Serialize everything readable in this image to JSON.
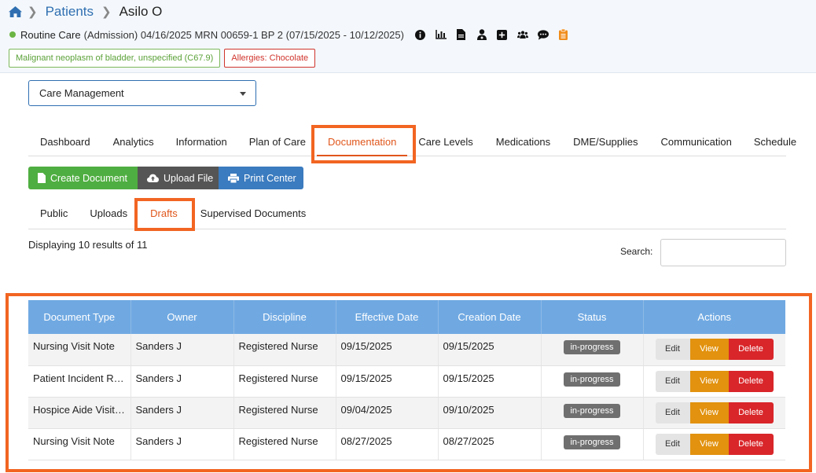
{
  "breadcrumb": {
    "home_icon": "home-icon",
    "patients": "Patients",
    "patient": "Asilo O"
  },
  "visit": {
    "status_color": "#6bb544",
    "type": "Routine Care",
    "details": "(Admission) 04/16/2025 MRN 00659-1 BP 2 (07/15/2025 - 10/12/2025)",
    "icons": [
      "info-icon",
      "bar-chart-icon",
      "document-icon",
      "user-doctor-icon",
      "plus-square-icon",
      "users-icon",
      "chat-icon",
      "clipboard-icon"
    ]
  },
  "tags": {
    "diagnosis": "Malignant neoplasm of bladder, unspecified (C67.9)",
    "allergies": "Allergies: Chocolate"
  },
  "care_select": {
    "value": "Care Management"
  },
  "tabs": [
    "Dashboard",
    "Analytics",
    "Information",
    "Plan of Care",
    "Documentation",
    "Care Levels",
    "Medications",
    "DME/Supplies",
    "Communication",
    "Schedule"
  ],
  "active_tab": "Documentation",
  "actions": {
    "create": "Create Document",
    "upload": "Upload File",
    "print": "Print Center"
  },
  "subtabs": [
    "Public",
    "Uploads",
    "Drafts",
    "Supervised Documents"
  ],
  "active_subtab": "Drafts",
  "results": "Displaying 10 results of 11",
  "search": {
    "label": "Search:",
    "value": ""
  },
  "table": {
    "columns": [
      "Document Type",
      "Owner",
      "Discipline",
      "Effective Date",
      "Creation Date",
      "Status",
      "Actions"
    ],
    "rows": [
      {
        "doc_type": "Nursing Visit Note",
        "owner": "Sanders J",
        "discipline": "Registered Nurse",
        "effective": "09/15/2025",
        "created": "09/15/2025",
        "status": "in-progress"
      },
      {
        "doc_type": "Patient Incident Report",
        "owner": "Sanders J",
        "discipline": "Registered Nurse",
        "effective": "09/15/2025",
        "created": "09/15/2025",
        "status": "in-progress"
      },
      {
        "doc_type": "Hospice Aide Visit Note",
        "owner": "Sanders J",
        "discipline": "Registered Nurse",
        "effective": "09/04/2025",
        "created": "09/10/2025",
        "status": "in-progress"
      },
      {
        "doc_type": "Nursing Visit Note",
        "owner": "Sanders J",
        "discipline": "Registered Nurse",
        "effective": "08/27/2025",
        "created": "08/27/2025",
        "status": "in-progress"
      }
    ],
    "row_actions": {
      "edit": "Edit",
      "view": "View",
      "delete": "Delete"
    }
  },
  "colors": {
    "accent": "#f26522",
    "link": "#2f6fb1",
    "header_row": "#70a9e2",
    "green": "#4fae41",
    "blue": "#3b7bbf",
    "orange_view": "#e2920f",
    "red_delete": "#d9262a"
  }
}
